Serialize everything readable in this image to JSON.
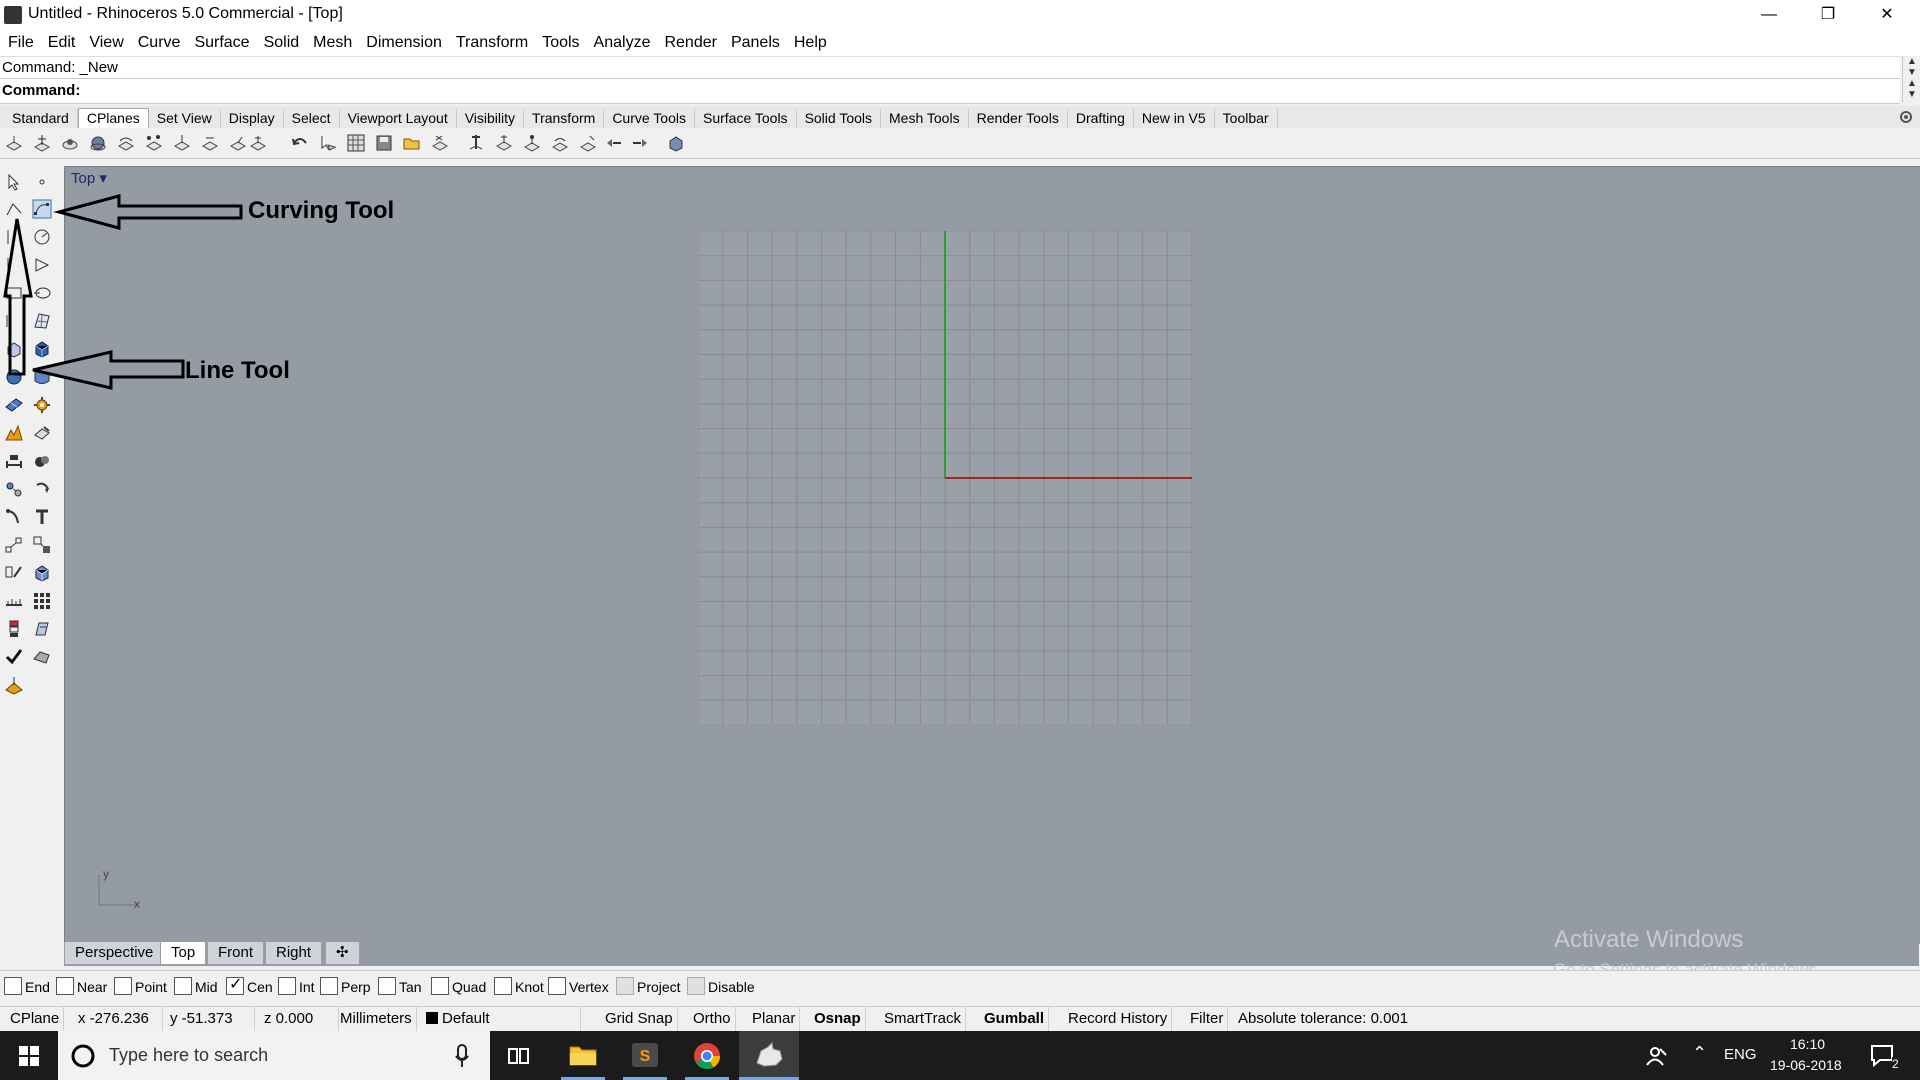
{
  "window": {
    "title": "Untitled - Rhinoceros 5.0 Commercial - [Top]",
    "minimize": "—",
    "restore": "❐",
    "close": "✕"
  },
  "menu": [
    "File",
    "Edit",
    "View",
    "Curve",
    "Surface",
    "Solid",
    "Mesh",
    "Dimension",
    "Transform",
    "Tools",
    "Analyze",
    "Render",
    "Panels",
    "Help"
  ],
  "command": {
    "history": "Command: _New",
    "prompt": "Command:",
    "value": ""
  },
  "toolbar_tabs": [
    "Standard",
    "CPlanes",
    "Set View",
    "Display",
    "Select",
    "Viewport Layout",
    "Visibility",
    "Transform",
    "Curve Tools",
    "Surface Tools",
    "Solid Tools",
    "Mesh Tools",
    "Render Tools",
    "Drafting",
    "New in V5",
    "Toolbar"
  ],
  "active_toolbar_tab": "CPlanes",
  "viewport": {
    "title": "Top",
    "axis_y": "y",
    "axis_x": "x"
  },
  "annotations": {
    "curving": "Curving Tool",
    "line": "Line Tool"
  },
  "view_tabs": [
    "Perspective",
    "Top",
    "Front",
    "Right"
  ],
  "active_view_tab": "Top",
  "view_tab_add": "✣",
  "watermark": {
    "line1": "Activate Windows",
    "line2": "Go to Settings to activate Windows."
  },
  "osnaps": [
    {
      "label": "End",
      "checked": false
    },
    {
      "label": "Near",
      "checked": false
    },
    {
      "label": "Point",
      "checked": false
    },
    {
      "label": "Mid",
      "checked": false
    },
    {
      "label": "Cen",
      "checked": true
    },
    {
      "label": "Int",
      "checked": false
    },
    {
      "label": "Perp",
      "checked": false
    },
    {
      "label": "Tan",
      "checked": false
    },
    {
      "label": "Quad",
      "checked": false
    },
    {
      "label": "Knot",
      "checked": false
    },
    {
      "label": "Vertex",
      "checked": false
    },
    {
      "label": "Project",
      "checked": false,
      "disabled": true
    },
    {
      "label": "Disable",
      "checked": false,
      "disabled": true
    }
  ],
  "status": {
    "cplane": "CPlane",
    "x": "x -276.236",
    "y": "y -51.373",
    "z": "z 0.000",
    "units": "Millimeters",
    "layer": "Default",
    "grid_snap": "Grid Snap",
    "ortho": "Ortho",
    "planar": "Planar",
    "osnap": "Osnap",
    "smarttrack": "SmartTrack",
    "gumball": "Gumball",
    "record_history": "Record History",
    "filter": "Filter",
    "tolerance": "Absolute tolerance: 0.001"
  },
  "taskbar": {
    "search_placeholder": "Type here to search",
    "lang": "ENG",
    "time": "16:10",
    "date": "19-06-2018",
    "notifications": "2"
  },
  "colors": {
    "viewport_bg": "#959ba3",
    "grid_line": "#848991",
    "y_axis": "#2f9e2f",
    "x_axis": "#b02020",
    "taskbar": "#1b1b1b"
  }
}
